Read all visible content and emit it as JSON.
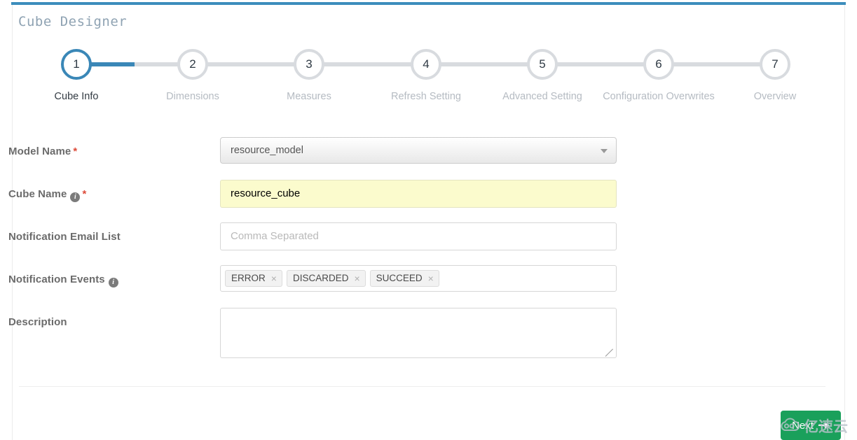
{
  "page": {
    "title": "Cube Designer",
    "accent_color": "#3c8dbc",
    "active_step_color": "#3a87b7",
    "inactive_step_color": "#d8dbdf",
    "required_marker": "*"
  },
  "stepper": {
    "active_index": 0,
    "steps": [
      {
        "number": "1",
        "label": "Cube Info"
      },
      {
        "number": "2",
        "label": "Dimensions"
      },
      {
        "number": "3",
        "label": "Measures"
      },
      {
        "number": "4",
        "label": "Refresh Setting"
      },
      {
        "number": "5",
        "label": "Advanced Setting"
      },
      {
        "number": "6",
        "label": "Configuration Overwrites"
      },
      {
        "number": "7",
        "label": "Overview"
      }
    ]
  },
  "form": {
    "model_name": {
      "label": "Model Name",
      "required": true,
      "value": "resource_model"
    },
    "cube_name": {
      "label": "Cube Name",
      "required": true,
      "has_info": true,
      "value": "resource_cube"
    },
    "notification_email": {
      "label": "Notification Email List",
      "required": false,
      "value": "",
      "placeholder": "Comma Separated"
    },
    "notification_events": {
      "label": "Notification Events",
      "has_info": true,
      "tags": [
        {
          "label": "ERROR",
          "remove": "×"
        },
        {
          "label": "DISCARDED",
          "remove": "×"
        },
        {
          "label": "SUCCEED",
          "remove": "×"
        }
      ]
    },
    "description": {
      "label": "Description",
      "value": ""
    }
  },
  "footer": {
    "next_label": "Next",
    "next_color": "#1aa05b"
  },
  "watermark": {
    "text": "亿速云"
  }
}
